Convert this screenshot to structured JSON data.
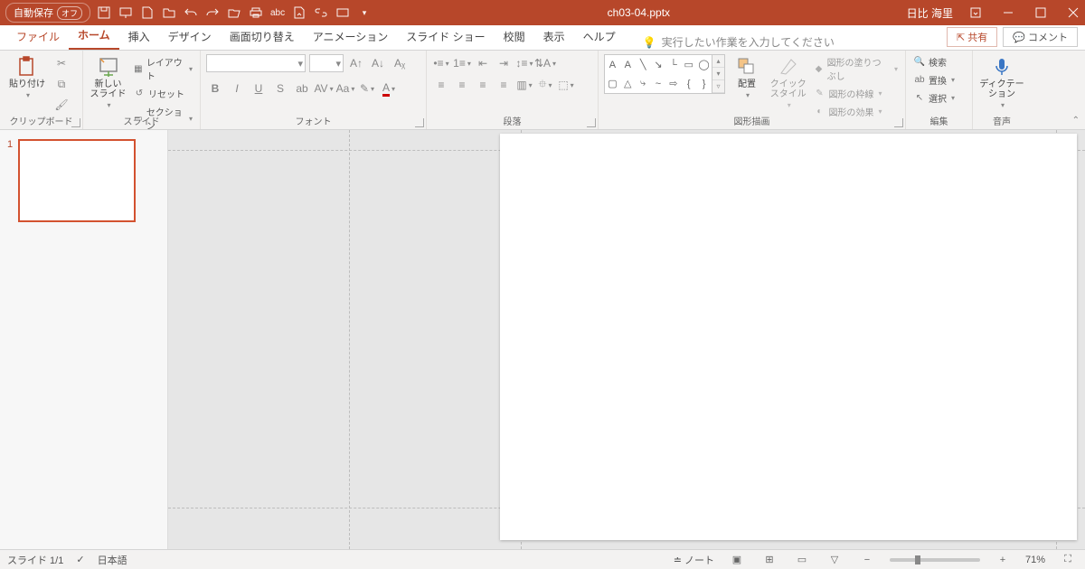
{
  "titlebar": {
    "autosave_label": "自動保存",
    "autosave_state": "オフ",
    "filename": "ch03-04.pptx",
    "username": "日比 海里"
  },
  "tabs": {
    "file": "ファイル",
    "home": "ホーム",
    "insert": "挿入",
    "design": "デザイン",
    "transitions": "画面切り替え",
    "animations": "アニメーション",
    "slideshow": "スライド ショー",
    "review": "校閲",
    "view": "表示",
    "help": "ヘルプ",
    "tellme": "実行したい作業を入力してください",
    "share": "共有",
    "comments": "コメント"
  },
  "ribbon": {
    "clipboard": {
      "label": "クリップボード",
      "paste": "貼り付け"
    },
    "slides": {
      "label": "スライド",
      "new_slide": "新しい\nスライド",
      "layout": "レイアウト",
      "reset": "リセット",
      "section": "セクション"
    },
    "font": {
      "label": "フォント"
    },
    "paragraph": {
      "label": "段落"
    },
    "drawing": {
      "label": "図形描画",
      "arrange": "配置",
      "quickstyles": "クイック\nスタイル",
      "fill": "図形の塗りつぶし",
      "outline": "図形の枠線",
      "effects": "図形の効果"
    },
    "editing": {
      "label": "編集",
      "find": "検索",
      "replace": "置換",
      "select": "選択"
    },
    "voice": {
      "label": "音声",
      "dictate": "ディクテー\nション"
    }
  },
  "thumbs": {
    "num1": "1"
  },
  "status": {
    "slide_count": "スライド 1/1",
    "language": "日本語",
    "notes": "ノート",
    "zoom": "71%"
  }
}
